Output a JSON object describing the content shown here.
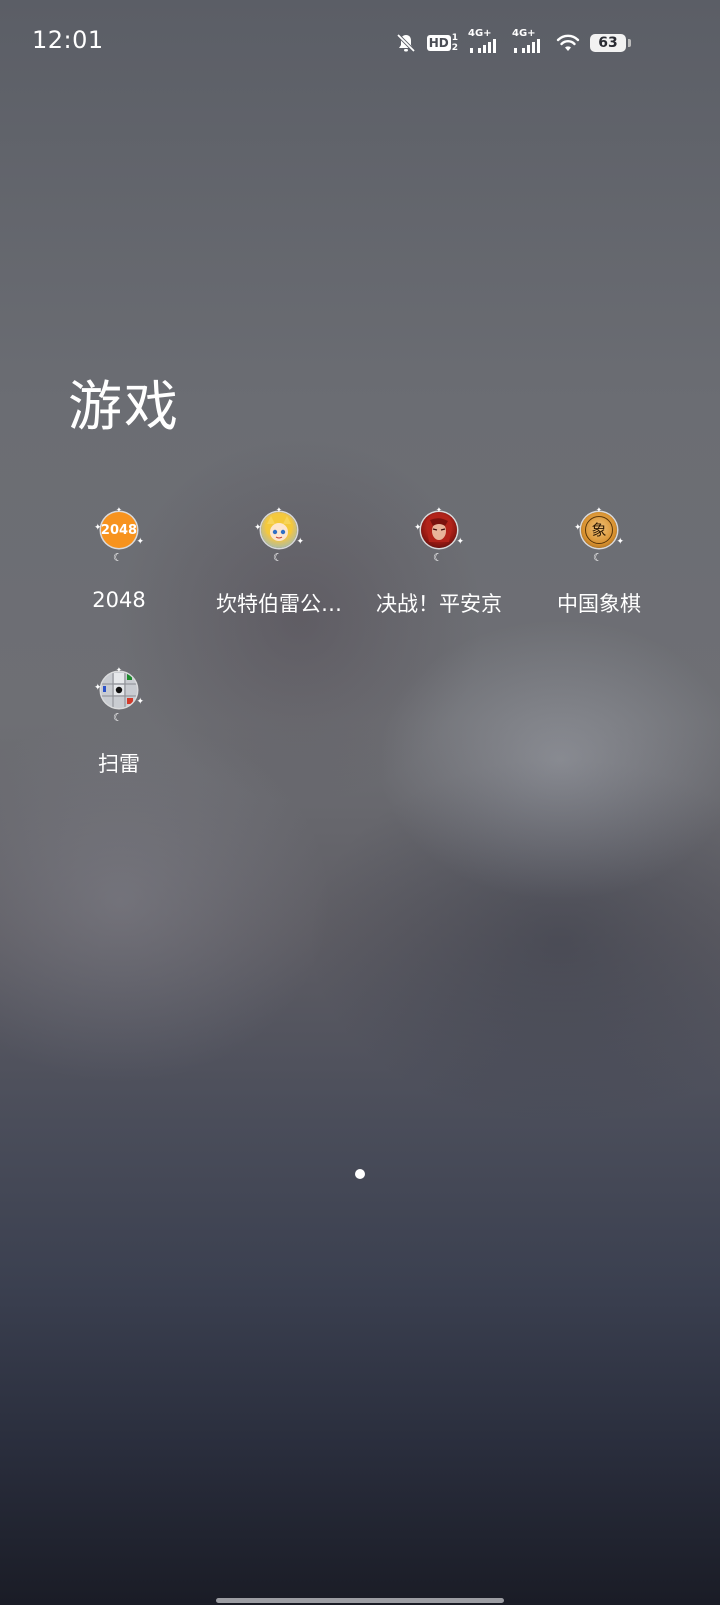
{
  "status_bar": {
    "time": "12:01",
    "icons": [
      "mute-bell-icon",
      "hd-volte-icon",
      "4g-signal-icon",
      "4g-signal-icon",
      "wifi-icon",
      "battery-icon"
    ],
    "hd_text": "HD",
    "sim1": "1",
    "sim2": "2",
    "network1": "4G+",
    "network2": "4G+",
    "battery_level": "63"
  },
  "folder": {
    "title": "游戏",
    "apps": [
      {
        "label": "2048",
        "icon": "2048-icon",
        "icon_text": "2048"
      },
      {
        "label": "坎特伯雷公…",
        "icon": "kanterbury-anime-girl-icon"
      },
      {
        "label": "决战！平安京",
        "icon": "heian-warrior-icon"
      },
      {
        "label": "中国象棋",
        "icon": "chinese-chess-icon",
        "icon_text": "象"
      },
      {
        "label": "扫雷",
        "icon": "minesweeper-icon"
      }
    ]
  },
  "page_indicator": {
    "pages": 1,
    "current": 1
  },
  "colors": {
    "text": "#ffffff",
    "icon_2048": "#f7931e"
  }
}
